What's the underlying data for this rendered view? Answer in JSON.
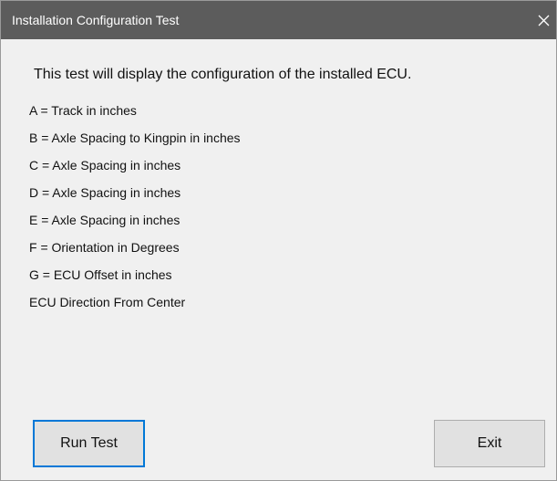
{
  "window": {
    "title": "Installation Configuration Test",
    "close_icon": "close-icon"
  },
  "content": {
    "intro": "This test will display the configuration of the installed ECU.",
    "parameters": [
      "A = Track in inches",
      "B = Axle Spacing to Kingpin in inches",
      "C = Axle Spacing in inches",
      "D = Axle Spacing in inches",
      "E = Axle Spacing in inches",
      "F = Orientation in Degrees",
      "G = ECU Offset in inches",
      "ECU Direction From Center"
    ]
  },
  "buttons": {
    "run_test": "Run Test",
    "exit": "Exit"
  },
  "colors": {
    "titlebar": "#5c5c5c",
    "title_text": "#ffffff",
    "window_background": "#f0f0f0",
    "button_face": "#e1e1e1",
    "focus_border": "#0078d7"
  }
}
